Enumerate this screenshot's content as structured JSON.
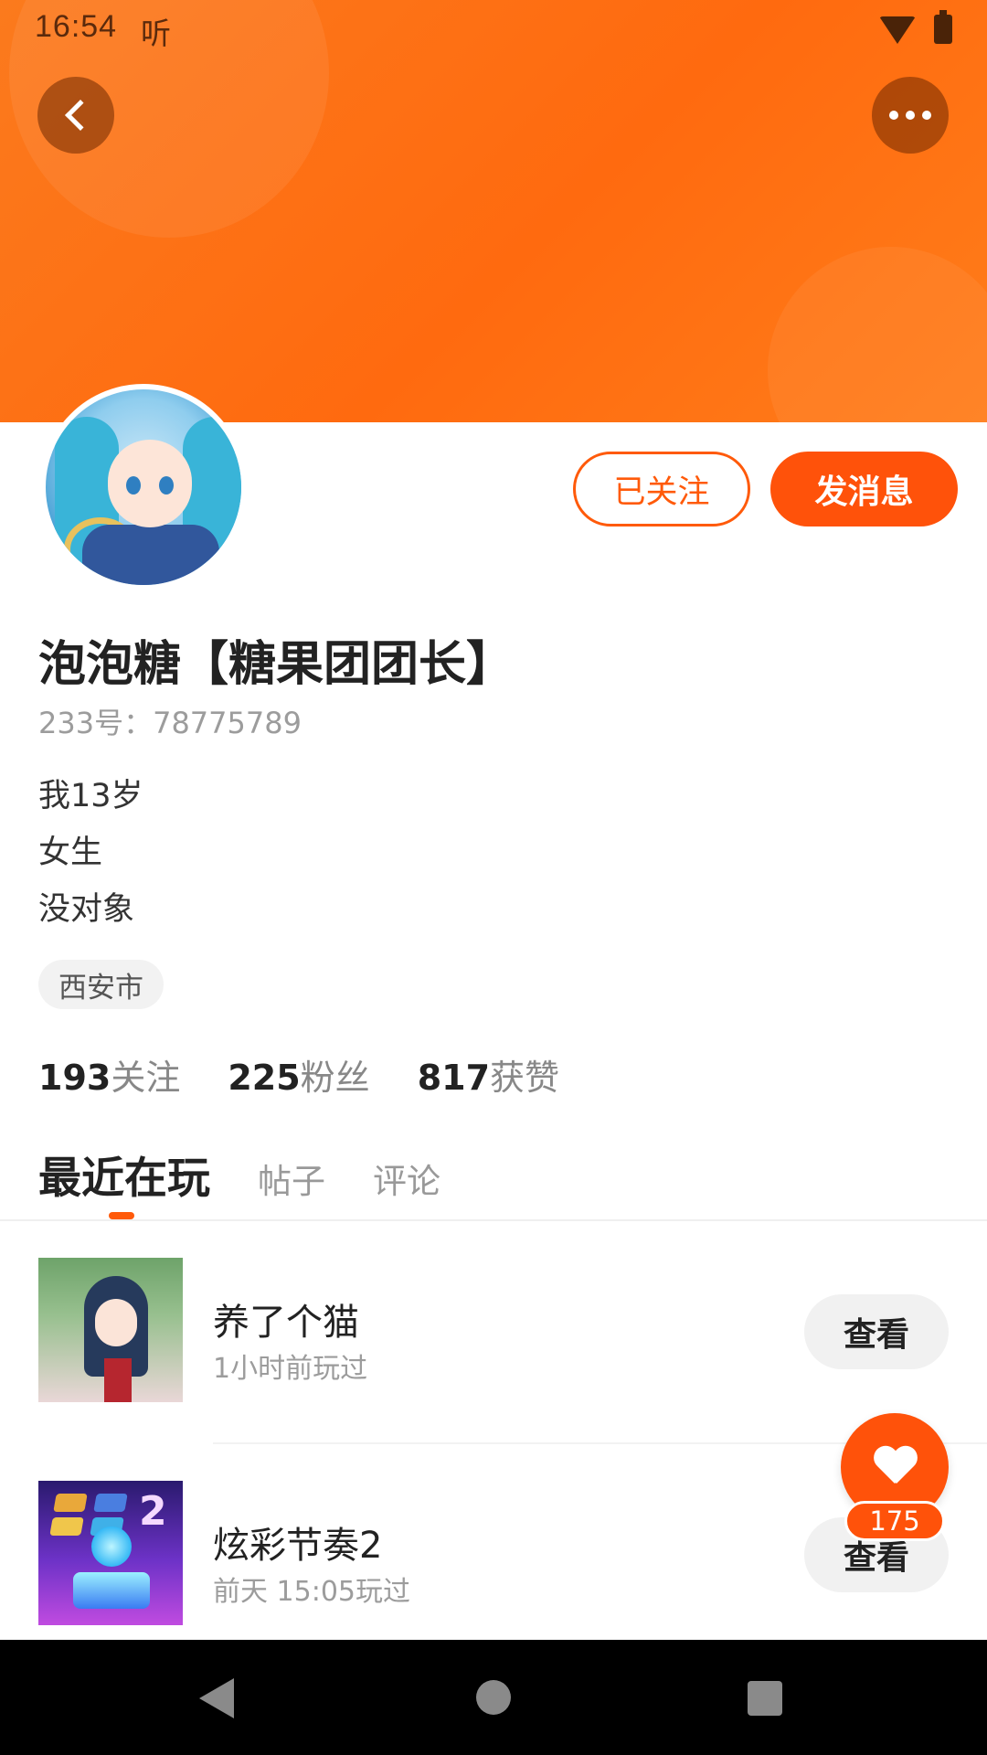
{
  "status_bar": {
    "time": "16:54",
    "app_indicator": "听",
    "icons": [
      "wifi-icon",
      "battery-icon"
    ]
  },
  "header": {
    "back_icon": "chevron-left-icon",
    "more_icon": "more-dots-icon"
  },
  "profile": {
    "follow_label": "已关注",
    "message_label": "发消息",
    "nickname": "泡泡糖【糖果团团长】",
    "user_id": "233号：78775789",
    "bio": [
      "我13岁",
      "女生",
      "没对象"
    ],
    "location": "西安市"
  },
  "stats": [
    {
      "value": "193",
      "label": "关注"
    },
    {
      "value": "225",
      "label": "粉丝"
    },
    {
      "value": "817",
      "label": "获赞"
    }
  ],
  "tabs": [
    {
      "label": "最近在玩",
      "active": true
    },
    {
      "label": "帖子",
      "active": false
    },
    {
      "label": "评论",
      "active": false
    }
  ],
  "games": [
    {
      "title": "养了个猫",
      "meta": "1小时前玩过",
      "button": "查看"
    },
    {
      "title": "炫彩节奏2",
      "meta": "前天 15:05玩过",
      "button": "查看"
    }
  ],
  "like_fab": {
    "icon": "heart-icon",
    "count": "175"
  },
  "colors": {
    "accent": "#ff520a",
    "header_bg": "#fb7a1d"
  },
  "nav_bar": {
    "icons": [
      "nav-back-icon",
      "nav-home-icon",
      "nav-recent-icon"
    ]
  }
}
